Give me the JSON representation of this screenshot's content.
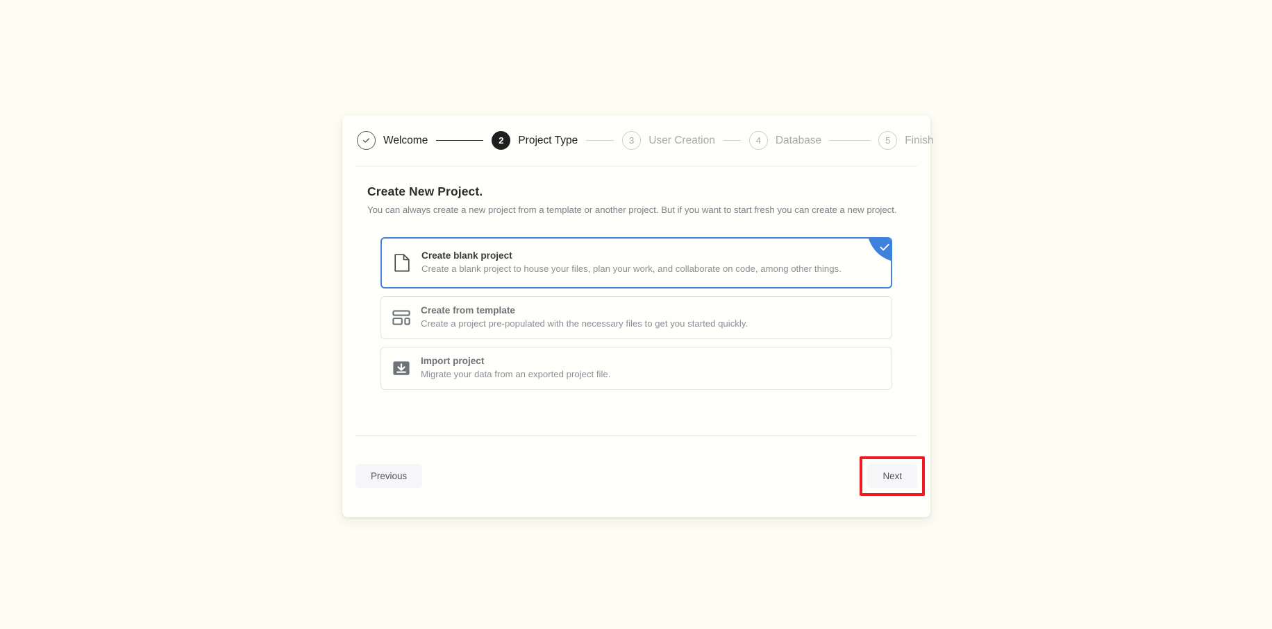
{
  "stepper": {
    "steps": [
      {
        "id": "welcome",
        "marker": "check",
        "label": "Welcome",
        "state": "done"
      },
      {
        "id": "project-type",
        "marker": "2",
        "label": "Project Type",
        "state": "current"
      },
      {
        "id": "user-creation",
        "marker": "3",
        "label": "User Creation",
        "state": "upcoming"
      },
      {
        "id": "database",
        "marker": "4",
        "label": "Database",
        "state": "upcoming"
      },
      {
        "id": "finish",
        "marker": "5",
        "label": "Finish",
        "state": "upcoming"
      }
    ]
  },
  "main": {
    "title": "Create New Project.",
    "subtitle": "You can always create a new project from a template or another project. But if you want to start fresh you can create a new project.",
    "options": [
      {
        "id": "create-blank-project",
        "icon": "file-icon",
        "title": "Create blank project",
        "description": "Create a blank project to house your files, plan your work, and collaborate on code, among other things.",
        "selected": true
      },
      {
        "id": "create-from-template",
        "icon": "template-layout-icon",
        "title": "Create from template",
        "description": "Create a project pre-populated with the necessary files to get you started quickly.",
        "selected": false
      },
      {
        "id": "import-project",
        "icon": "import-download-icon",
        "title": "Import project",
        "description": "Migrate your data from an exported project file.",
        "selected": false
      }
    ]
  },
  "footer": {
    "previous_label": "Previous",
    "next_label": "Next"
  },
  "colors": {
    "page_background": "#fdfdf4",
    "card_background": "#fefefb",
    "accent_blue": "#3f82dd",
    "highlight_red": "#ee1b24",
    "current_step": "#1f1f1f",
    "muted_text": "#8b9097"
  }
}
